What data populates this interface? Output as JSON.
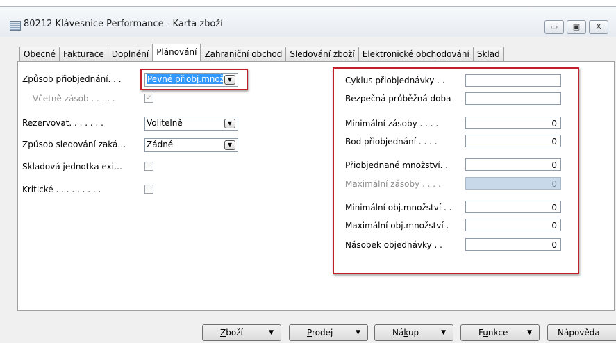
{
  "window": {
    "title": "80212 Klávesnice Performance - Karta zboží",
    "controls": {
      "minimize": "▭",
      "maximize": "▣",
      "close": "X"
    }
  },
  "tabs": [
    {
      "label": "Obecné"
    },
    {
      "label": "Fakturace"
    },
    {
      "label": "Doplnění"
    },
    {
      "label": "Plánování",
      "active": true
    },
    {
      "label": "Zahraniční obchod"
    },
    {
      "label": "Sledování zboží"
    },
    {
      "label": "Elektronické obchodování"
    },
    {
      "label": "Sklad"
    }
  ],
  "left": {
    "replenishment_method": {
      "label": "Způsob přiobjednání. . .",
      "value": "Pevné přiobj.množ"
    },
    "include_inventory": {
      "label": "Včetně zásob . . . . .",
      "checked": true,
      "disabled": true
    },
    "reserve": {
      "label": "Rezervovat. . . . . . .",
      "value": "Volitelně"
    },
    "order_tracking": {
      "label": "Způsob sledování zaká…",
      "value": "Žádné"
    },
    "sku_exists": {
      "label": "Skladová jednotka exi…",
      "checked": false
    },
    "critical": {
      "label": "Kritické . . . . . . . . .",
      "checked": false
    }
  },
  "right": {
    "fields": [
      {
        "label": "Cyklus přiobjednávky . .",
        "value": ""
      },
      {
        "label": "Bezpečná průběžná doba",
        "value": ""
      },
      {
        "label": "Minimální zásoby . . . .",
        "value": "0"
      },
      {
        "label": "Bod přiobjednání . . . .",
        "value": "0"
      },
      {
        "label": "Přiobjednané množství. .",
        "value": "0"
      },
      {
        "label": "Maximální zásoby . . . .",
        "value": "0",
        "disabled": true
      },
      {
        "label": "Minimální obj.množství . .",
        "value": "0"
      },
      {
        "label": "Maximální obj.množství .",
        "value": "0"
      },
      {
        "label": "Násobek objednávky . .",
        "value": "0"
      }
    ]
  },
  "buttons": {
    "item": {
      "accel": "Z",
      "rest": "boží",
      "arrow": "▼"
    },
    "sales": {
      "accel": "P",
      "rest": "rodej",
      "arrow": "▼"
    },
    "purchase": {
      "pre": "Ná",
      "accel": "k",
      "rest": "up",
      "arrow": "▼"
    },
    "functions": {
      "pre": "F",
      "accel": "u",
      "rest": "nkce",
      "arrow": "▼"
    },
    "help": {
      "label": "Nápověda"
    }
  },
  "colors": {
    "highlight": "#c0202a",
    "selection": "#3399ff"
  }
}
